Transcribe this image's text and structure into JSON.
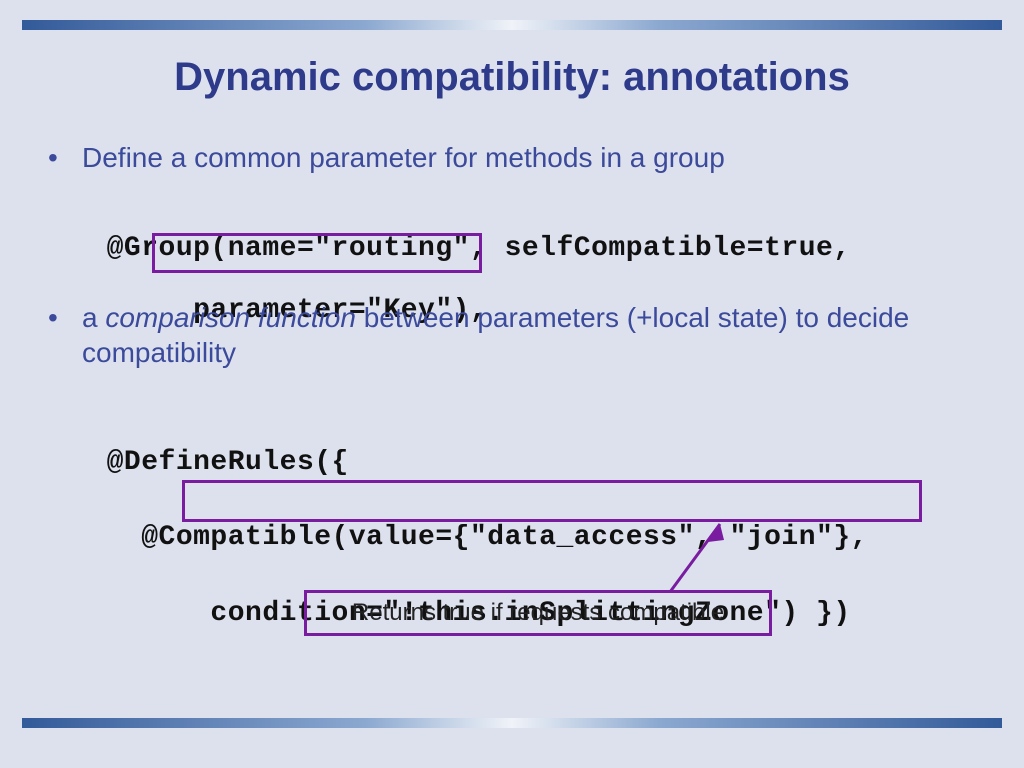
{
  "title": "Dynamic compatibility: annotations",
  "bullet1": "Define a common parameter for methods in a group",
  "code1_line1": "@Group(name=\"routing\", selfCompatible=true,",
  "code1_line2": "     parameter=\"Key\"),",
  "bullet2_a": "a ",
  "bullet2_b": "comparison function",
  "bullet2_c": " between parameters (+local state) to decide compatibility",
  "code2_line1": "@DefineRules({",
  "code2_line2a": "  @Compatible",
  "code2_line2b": "(value={\"data_access\", \"join\"},",
  "code2_line3": "      condition=\"!this.inSplittingZone\") })",
  "callout": "Returns true if requests compatible"
}
